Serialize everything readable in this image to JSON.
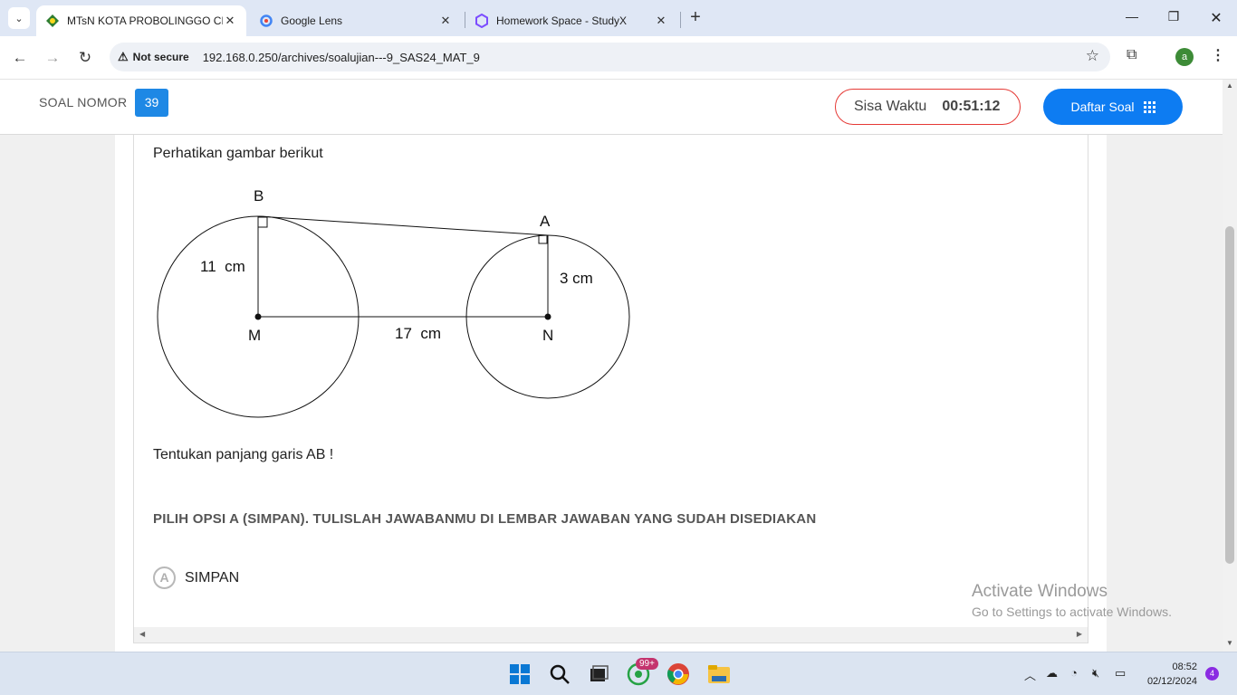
{
  "browser": {
    "tabs": [
      {
        "title": "MTsN KOTA PROBOLINGGO CB",
        "active": true
      },
      {
        "title": "Google Lens",
        "active": false
      },
      {
        "title": "Homework Space - StudyX",
        "active": false
      }
    ],
    "security_label": "Not secure",
    "url": "192.168.0.250/archives/soalujian---9_SAS24_MAT_9",
    "profile_initial": "a"
  },
  "header": {
    "soal_label": "SOAL NOMOR",
    "soal_number": "39",
    "timer_label": "Sisa Waktu",
    "timer_value": "00:51:12",
    "daftar_label": "Daftar Soal"
  },
  "question": {
    "intro": "Perhatikan gambar berikut",
    "figure": {
      "point_b": "B",
      "point_a": "A",
      "point_m": "M",
      "point_n": "N",
      "radius_big": "11  cm",
      "radius_small": "3 cm",
      "distance": "17  cm"
    },
    "ask": "Tentukan panjang garis AB !",
    "instruction": "PILIH OPSI A (SIMPAN). TULISLAH JAWABANMU DI LEMBAR JAWABAN YANG SUDAH DISEDIAKAN",
    "options": [
      {
        "letter": "A",
        "text": "SIMPAN"
      }
    ]
  },
  "watermark": {
    "line1": "Activate Windows",
    "line2": "Go to Settings to activate Windows."
  },
  "taskbar": {
    "whatsapp_badge": "99+",
    "time": "08:52",
    "date": "02/12/2024",
    "notification_count": "4"
  },
  "colors": {
    "accent": "#0d7cf2",
    "number_badge": "#1e88e5",
    "timer_border": "#e53935"
  }
}
